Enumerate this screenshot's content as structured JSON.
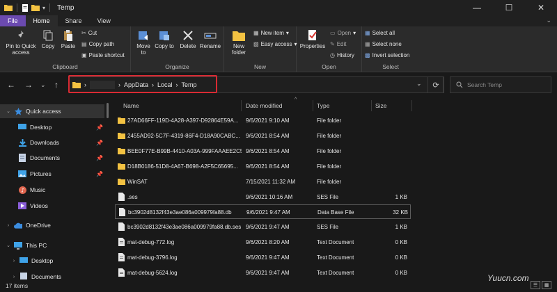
{
  "window": {
    "title": "Temp"
  },
  "window_controls": {
    "minimize": "—",
    "maximize": "☐",
    "close": "✕"
  },
  "tabs": [
    {
      "label": "File"
    },
    {
      "label": "Home"
    },
    {
      "label": "Share"
    },
    {
      "label": "View"
    }
  ],
  "ribbon": {
    "clipboard": {
      "label": "Clipboard",
      "pin": "Pin to Quick access",
      "copy": "Copy",
      "paste": "Paste",
      "cut": "Cut",
      "copy_path": "Copy path",
      "paste_shortcut": "Paste shortcut"
    },
    "organize": {
      "label": "Organize",
      "move_to": "Move to",
      "copy_to": "Copy to",
      "delete": "Delete",
      "rename": "Rename"
    },
    "new": {
      "label": "New",
      "new_folder": "New folder",
      "new_item": "New item",
      "easy_access": "Easy access"
    },
    "open": {
      "label": "Open",
      "properties": "Properties",
      "open": "Open",
      "edit": "Edit",
      "history": "History"
    },
    "select": {
      "label": "Select",
      "select_all": "Select all",
      "select_none": "Select none",
      "invert": "Invert selection"
    }
  },
  "address": {
    "crumbs": [
      "AppData",
      "Local",
      "Temp"
    ],
    "separator": "›"
  },
  "search": {
    "placeholder": "Search Temp"
  },
  "nav": {
    "items": [
      {
        "label": "Quick access",
        "icon": "star-icon",
        "pinned": false
      },
      {
        "label": "Desktop",
        "icon": "desktop-icon",
        "pinned": true
      },
      {
        "label": "Downloads",
        "icon": "download-icon",
        "pinned": true
      },
      {
        "label": "Documents",
        "icon": "document-icon",
        "pinned": true
      },
      {
        "label": "Pictures",
        "icon": "pictures-icon",
        "pinned": true
      },
      {
        "label": "Music",
        "icon": "music-icon",
        "pinned": false
      },
      {
        "label": "Videos",
        "icon": "videos-icon",
        "pinned": false
      },
      {
        "label": "OneDrive",
        "icon": "cloud-icon",
        "pinned": false
      },
      {
        "label": "This PC",
        "icon": "pc-icon",
        "pinned": false
      },
      {
        "label": "Desktop",
        "icon": "desktop-icon",
        "pinned": false
      },
      {
        "label": "Documents",
        "icon": "document-icon",
        "pinned": false
      }
    ]
  },
  "columns": {
    "name": "Name",
    "date": "Date modified",
    "type": "Type",
    "size": "Size"
  },
  "files": [
    {
      "name": "27AD66FF-119D-4A28-A397-D92864E59A...",
      "date": "9/6/2021 9:10 AM",
      "type": "File folder",
      "size": "",
      "kind": "folder"
    },
    {
      "name": "2455AD92-5C7F-4319-86F4-D18A90CABC...",
      "date": "9/6/2021 8:54 AM",
      "type": "File folder",
      "size": "",
      "kind": "folder"
    },
    {
      "name": "BEE0F77E-B99B-4410-A03A-999FAAAEE2C5",
      "date": "9/6/2021 8:54 AM",
      "type": "File folder",
      "size": "",
      "kind": "folder"
    },
    {
      "name": "D18B0186-51D8-4A67-B698-A2F5C65695...",
      "date": "9/6/2021 8:54 AM",
      "type": "File folder",
      "size": "",
      "kind": "folder"
    },
    {
      "name": "WinSAT",
      "date": "7/15/2021 11:32 AM",
      "type": "File folder",
      "size": "",
      "kind": "folder"
    },
    {
      "name": ".ses",
      "date": "9/6/2021 10:16 AM",
      "type": "SES File",
      "size": "1 KB",
      "kind": "file"
    },
    {
      "name": "bc3902d8132f43e3ae086a009979fa88.db",
      "date": "9/6/2021 9:47 AM",
      "type": "Data Base File",
      "size": "32 KB",
      "kind": "file"
    },
    {
      "name": "bc3902d8132f43e3ae086a009979fa88.db.ses",
      "date": "9/6/2021 9:47 AM",
      "type": "SES File",
      "size": "1 KB",
      "kind": "file"
    },
    {
      "name": "mat-debug-772.log",
      "date": "9/6/2021 8:20 AM",
      "type": "Text Document",
      "size": "0 KB",
      "kind": "file"
    },
    {
      "name": "mat-debug-3796.log",
      "date": "9/6/2021 9:47 AM",
      "type": "Text Document",
      "size": "0 KB",
      "kind": "file"
    },
    {
      "name": "mat-debug-5624.log",
      "date": "9/6/2021 9:47 AM",
      "type": "Text Document",
      "size": "0 KB",
      "kind": "file"
    }
  ],
  "status": {
    "items": "17 items"
  },
  "watermark": "Yuucn.com",
  "colors": {
    "file_tab": "#6b4ab0",
    "highlight": "#d92a33",
    "folder": "#f3c242"
  }
}
